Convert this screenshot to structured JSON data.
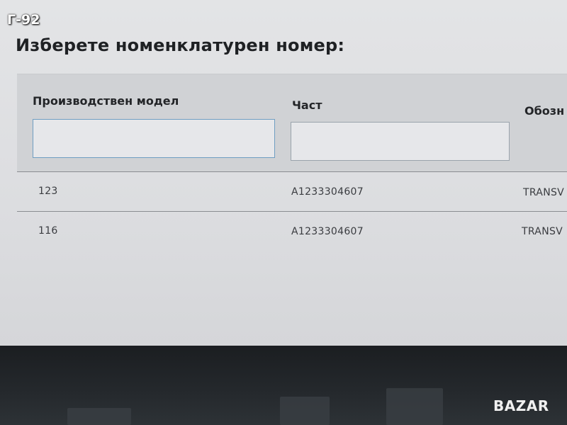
{
  "corner_tag": "Г-92",
  "page": {
    "title": "Изберете номенклатурен номер:"
  },
  "columns": {
    "model": "Производствен модел",
    "part": "Част",
    "designation": "Обозн"
  },
  "filters": {
    "model_value": "",
    "part_value": ""
  },
  "rows": [
    {
      "model": "123",
      "part": "A1233304607",
      "designation": "TRANSV"
    },
    {
      "model": "116",
      "part": "A1233304607",
      "designation": "TRANSV"
    }
  ],
  "watermark": "BAZAR",
  "colors": {
    "screen_bg": "#dcdde0",
    "filter_bar_bg": "#d0d2d5",
    "active_input_border": "#6f9ec2",
    "text": "#232528"
  }
}
